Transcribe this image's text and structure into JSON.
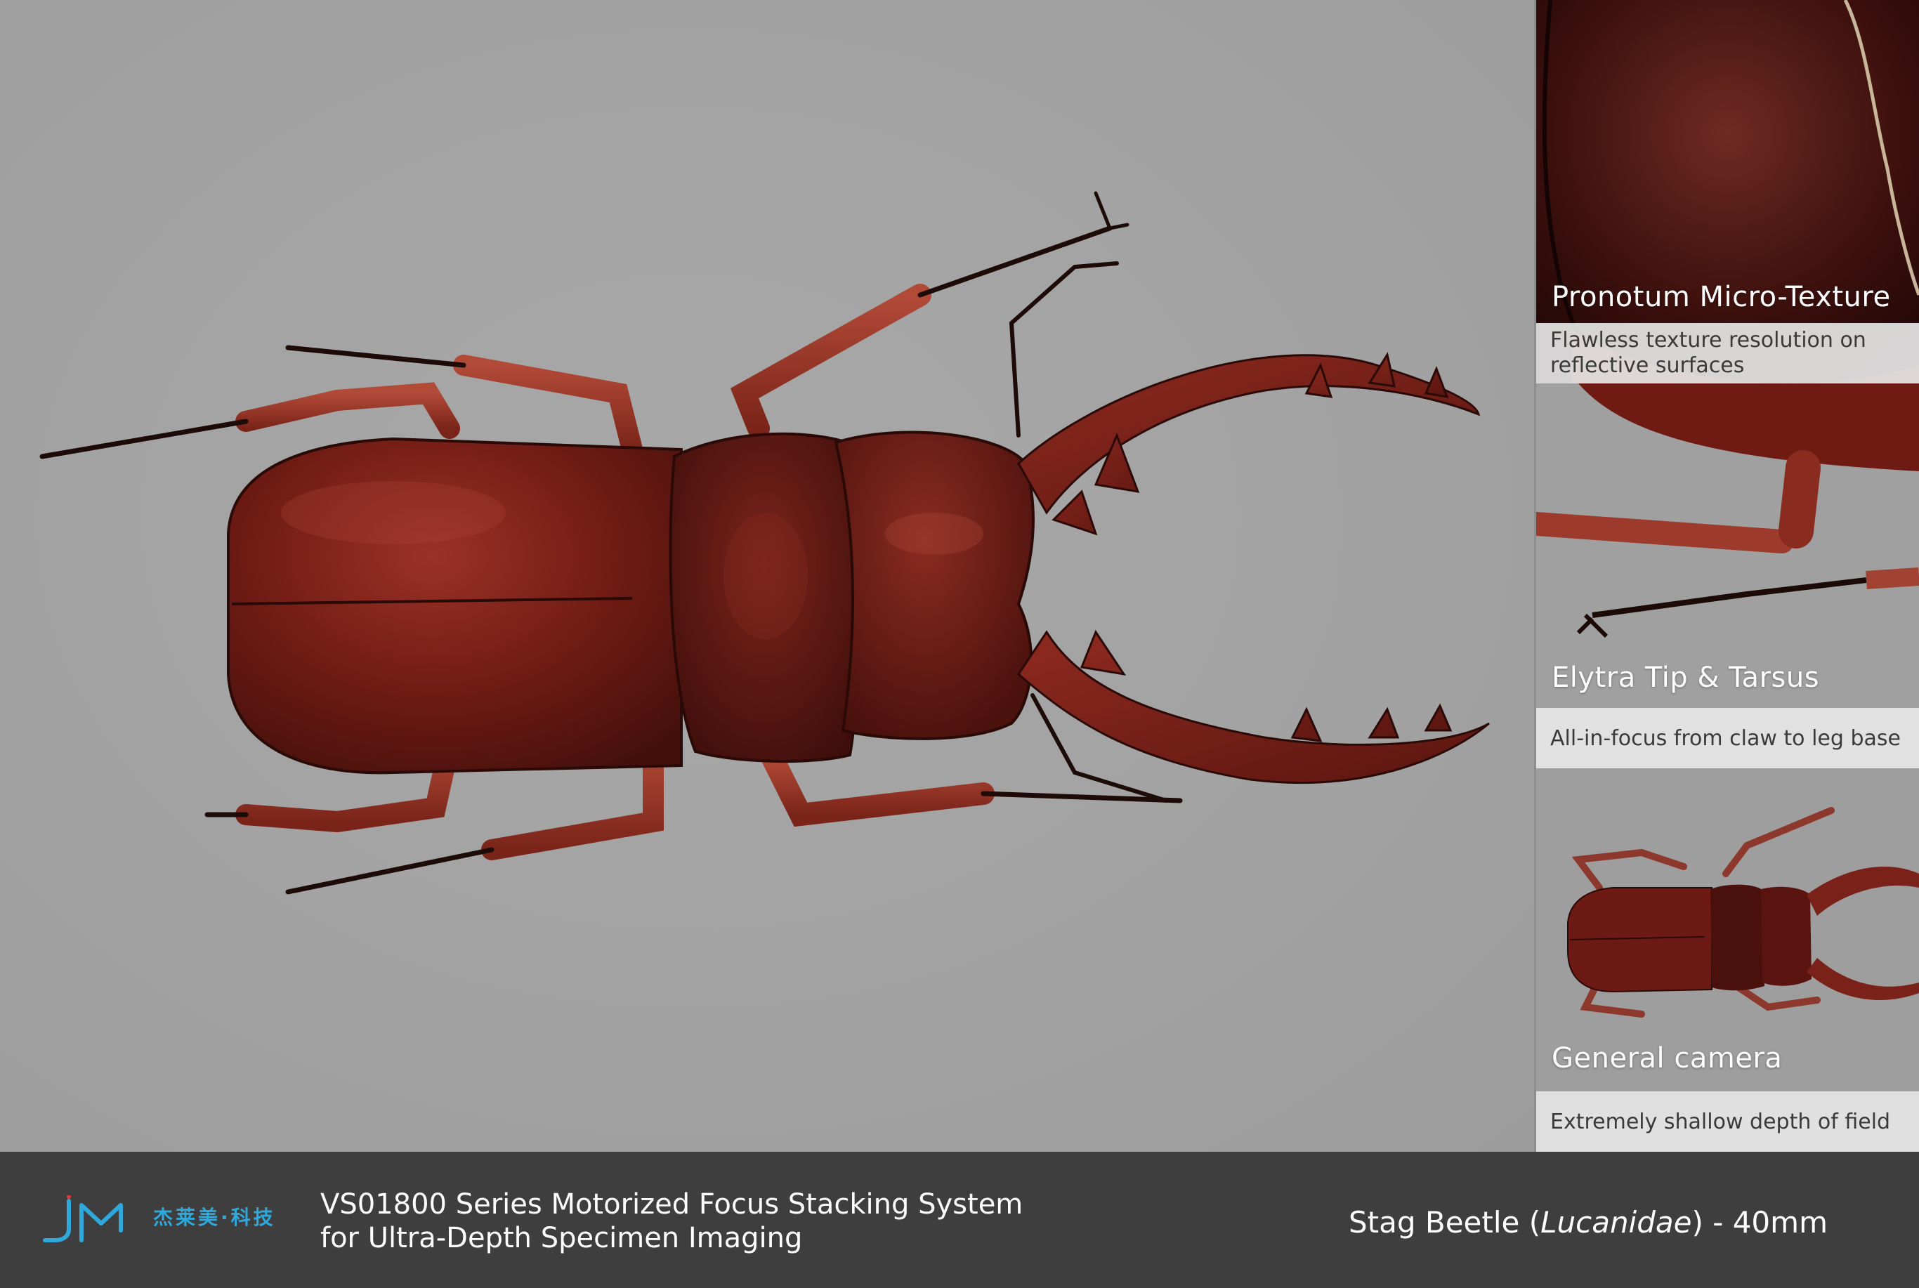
{
  "panel": {
    "tiles": [
      {
        "title": "Pronotum Micro-Texture",
        "caption": "Flawless texture resolution on reflective surfaces"
      },
      {
        "title": "Elytra Tip & Tarsus",
        "caption": "All-in-focus from claw to leg base"
      },
      {
        "title": "General camera",
        "caption": "Extremely shallow depth of field"
      }
    ]
  },
  "footer": {
    "logo_cn": "杰莱美·科技",
    "product_line1": "VS01800 Series Motorized Focus Stacking System",
    "product_line2": "for Ultra-Depth Specimen Imaging",
    "specimen_prefix": "Stag Beetle (",
    "specimen_latin": "Lucanidae",
    "specimen_suffix": ") - 40mm"
  },
  "colors": {
    "background": "#a2a2a2",
    "beetle_body": "#6e1a14",
    "beetle_highlight": "#8e2a22",
    "leg_red": "#9a3a2c",
    "footer_bg": "#3e3e3e",
    "logo_blue": "#2fa9dc"
  }
}
